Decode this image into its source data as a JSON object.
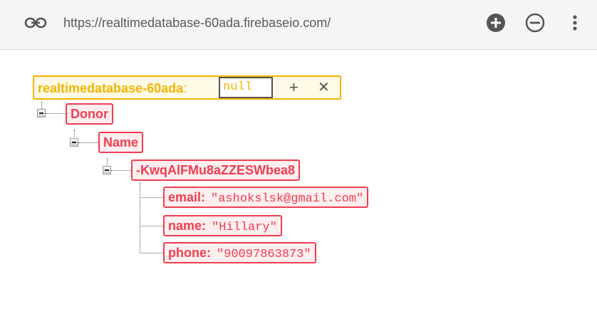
{
  "toolbar": {
    "url": "https://realtimedatabase-60ada.firebaseio.com/",
    "icons": [
      "link-icon",
      "add-circle-icon",
      "remove-circle-icon",
      "more-vert-icon"
    ]
  },
  "root": {
    "key": "realtimedatabase-60ada",
    "colon": ":",
    "value_input": "null",
    "add_label": "+",
    "close_label": "✕"
  },
  "tree": {
    "donor": "Donor",
    "name_node": "Name",
    "record_key": "-KwqAlFMu8aZZESWbea8",
    "fields": [
      {
        "key": "email:",
        "value": "\"ashokslsk@gmail.com\""
      },
      {
        "key": "name:",
        "value": "\"Hillary\""
      },
      {
        "key": "phone:",
        "value": "\"90097863873\""
      }
    ]
  },
  "colors": {
    "root_accent": "#f4b400",
    "node_accent": "#ef3e4f",
    "toolbar_bg": "#f5f5f5"
  }
}
